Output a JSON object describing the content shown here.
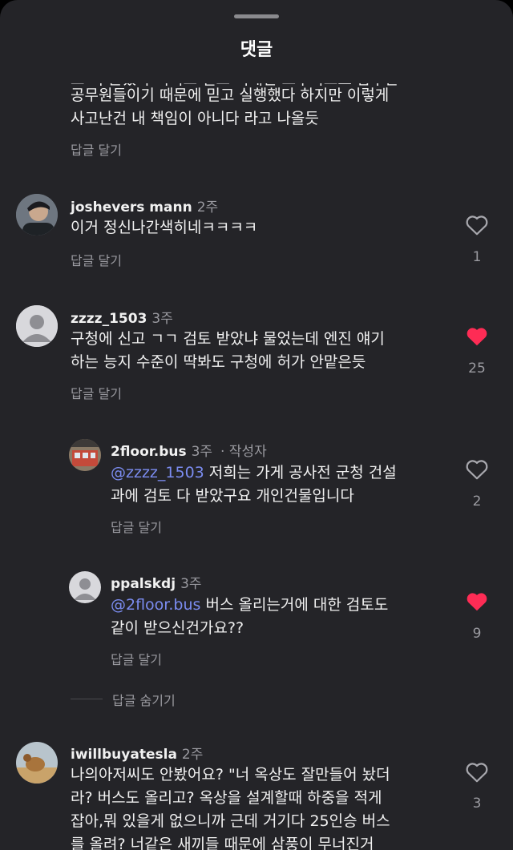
{
  "header": {
    "title": "댓글"
  },
  "reply_label": "답글 달기",
  "hide_replies_label": "답글 숨기기",
  "partial_comment": {
    "lines": [
      "오 더 준었다 이거고 믿고 외네안 오우국으로 답우관",
      "공무원들이기 때문에 믿고 실행했다 하지만 이렇게",
      "사고난건 내 책임이 아니다 라고 나올듯"
    ]
  },
  "comments": [
    {
      "username": "joshevers mann",
      "time": "2주",
      "lines": [
        "이거 정신나간색히네ㅋㅋㅋㅋ"
      ],
      "like_count": "1",
      "liked": false
    },
    {
      "username": "zzzz_1503",
      "time": "3주",
      "lines": [
        "구청에 신고 ㄱㄱ 검토 받았냐 물었는데 엔진 얘기",
        "하는 능지 수준이 딱봐도 구청에 허가 안맡은듯"
      ],
      "like_count": "25",
      "liked": true
    },
    {
      "username": "2floor.bus",
      "time": "3주",
      "author_tag": "· 작성자",
      "mention": "@zzzz_1503",
      "lines": [
        " 저희는 가게 공사전 군청 건설",
        "과에 검토 다 받았구요  개인건물입니다"
      ],
      "like_count": "2",
      "liked": false
    },
    {
      "username": "ppalskdj",
      "time": "3주",
      "mention": "@2floor.bus",
      "lines": [
        " 버스 올리는거에 대한 검토도",
        "같이 받으신건가요??"
      ],
      "like_count": "9",
      "liked": true
    },
    {
      "username": "iwillbuyatesla",
      "time": "2주",
      "lines": [
        "나의아저씨도 안봤어요? \"너 옥상도 잘만들어 놨더",
        "라? 버스도 올리고? 옥상을 설계할때 하중을 적게",
        "잡아,뭐 있을게 없으니까 근데 거기다 25인승 버스",
        "를 올려? 너같은 새끼들 때문에 삼풍이 무너진거"
      ],
      "like_count": "3",
      "liked": false
    }
  ],
  "colors": {
    "liked": "#fe2c55",
    "mention": "#7b8cf0",
    "background": "#242428"
  }
}
